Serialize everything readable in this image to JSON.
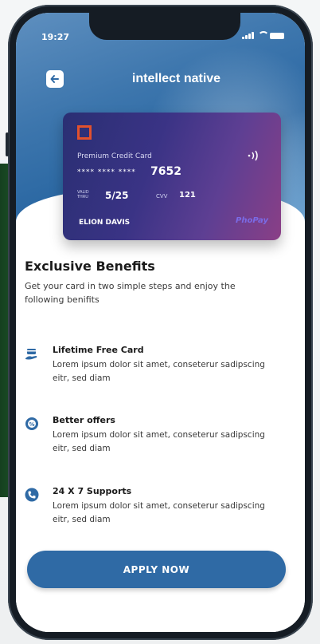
{
  "status_bar": {
    "time": "19:27"
  },
  "header": {
    "title": "intellect native"
  },
  "card": {
    "type_label": "Premium Credit Card",
    "masked_digits": "**** **** ****",
    "last_digits": "7652",
    "valid_label": "VALID THRU",
    "valid_value": "5/25",
    "cvv_label": "CVV",
    "cvv_value": "121",
    "holder": "ELION DAVIS",
    "brand_primary": "PhoPay",
    "brand_secondary": "",
    "colors": {
      "logo": "#e2512d",
      "start": "#2a2f73",
      "end": "#8a3f86"
    }
  },
  "benefits_section": {
    "title": "Exclusive Benefits",
    "description": "Get your card in two simple steps and enjoy the following benifits",
    "items": [
      {
        "icon": "card-hand-icon",
        "title": "Lifetime Free Card",
        "description": "Lorem ipsum dolor sit amet, conseterur sadipscing eitr, sed diam"
      },
      {
        "icon": "offer-badge-icon",
        "title": "Better offers",
        "description": "Lorem ipsum dolor sit amet, conseterur sadipscing eitr, sed diam"
      },
      {
        "icon": "support-phone-icon",
        "title": "24 X 7 Supports",
        "description": "Lorem ipsum dolor sit amet, conseterur sadipscing eitr, sed diam"
      }
    ]
  },
  "cta": {
    "label": "APPLY NOW"
  },
  "colors": {
    "accent": "#2f6aa5",
    "icon": "#2f6aa5"
  }
}
